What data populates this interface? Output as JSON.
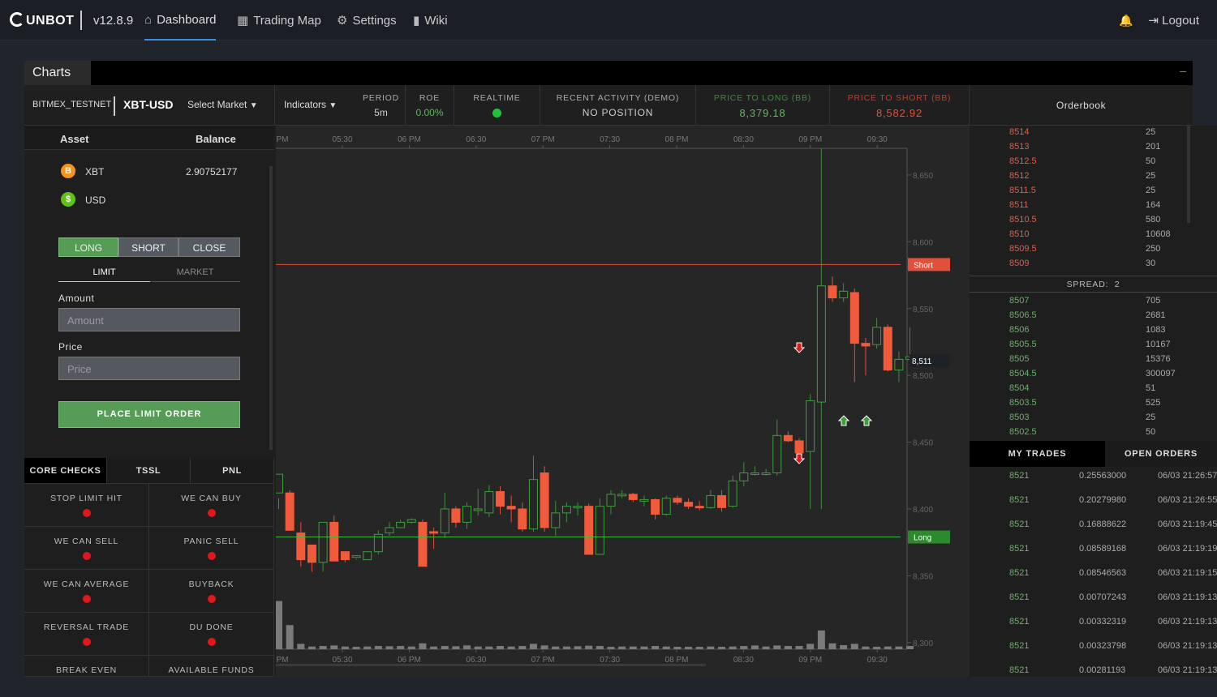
{
  "nav": {
    "logo": "UNBOT",
    "version": "v12.8.9",
    "items": [
      {
        "label": "Dashboard",
        "icon": "home-icon"
      },
      {
        "label": "Trading Map",
        "icon": "grid-icon"
      },
      {
        "label": "Settings",
        "icon": "gear-icon"
      },
      {
        "label": "Wiki",
        "icon": "book-icon"
      }
    ],
    "logout": "Logout"
  },
  "panel": {
    "title": "Charts",
    "minimize": "–"
  },
  "stats": {
    "exchange": "BITMEX_TESTNET",
    "pair": "XBT-USD",
    "select_market": "Select Market",
    "indicators": "Indicators",
    "period_label": "PERIOD",
    "period_value": "5m",
    "roe_label": "ROE",
    "roe_value": "0.00%",
    "realtime_label": "REALTIME",
    "activity_label": "RECENT ACTIVITY (DEMO)",
    "activity_value": "NO POSITION",
    "long_label": "PRICE TO LONG (BB)",
    "long_value": "8,379.18",
    "short_label": "PRICE TO SHORT (BB)",
    "short_value": "8,582.92",
    "colors": {
      "long": "#5fba5f",
      "short": "#e2503c",
      "realtime": "#22c33b"
    }
  },
  "balances": {
    "asset_header": "Asset",
    "balance_header": "Balance",
    "rows": [
      {
        "asset": "XBT",
        "balance": "2.90752177",
        "icon": "bitcoin-icon",
        "color": "#f7931a"
      },
      {
        "asset": "USD",
        "balance": "",
        "icon": "dollar-icon",
        "color": "#5fc316"
      }
    ]
  },
  "order_form": {
    "sides": [
      "LONG",
      "SHORT",
      "CLOSE"
    ],
    "types": [
      "LIMIT",
      "MARKET"
    ],
    "amount_label": "Amount",
    "amount_placeholder": "Amount",
    "price_label": "Price",
    "price_placeholder": "Price",
    "submit": "PLACE LIMIT ORDER"
  },
  "checks": {
    "tabs": [
      "CORE CHECKS",
      "TSSL",
      "PNL"
    ],
    "items": [
      "STOP LIMIT HIT",
      "WE CAN BUY",
      "WE CAN SELL",
      "PANIC SELL",
      "WE CAN AVERAGE",
      "BUYBACK",
      "REVERSAL TRADE",
      "DU DONE",
      "BREAK EVEN",
      "AVAILABLE FUNDS"
    ]
  },
  "orderbook": {
    "title": "Orderbook",
    "asks": [
      {
        "price": "8514",
        "qty": "25"
      },
      {
        "price": "8513",
        "qty": "201"
      },
      {
        "price": "8512.5",
        "qty": "50"
      },
      {
        "price": "8512",
        "qty": "25"
      },
      {
        "price": "8511.5",
        "qty": "25"
      },
      {
        "price": "8511",
        "qty": "164"
      },
      {
        "price": "8510.5",
        "qty": "580"
      },
      {
        "price": "8510",
        "qty": "10608"
      },
      {
        "price": "8509.5",
        "qty": "250"
      },
      {
        "price": "8509",
        "qty": "30"
      }
    ],
    "spread_label": "SPREAD:",
    "spread_value": "2",
    "bids": [
      {
        "price": "8507",
        "qty": "705"
      },
      {
        "price": "8506.5",
        "qty": "2681"
      },
      {
        "price": "8506",
        "qty": "1083"
      },
      {
        "price": "8505.5",
        "qty": "10167"
      },
      {
        "price": "8505",
        "qty": "15376"
      },
      {
        "price": "8504.5",
        "qty": "300097"
      },
      {
        "price": "8504",
        "qty": "51"
      },
      {
        "price": "8503.5",
        "qty": "525"
      },
      {
        "price": "8503",
        "qty": "25"
      },
      {
        "price": "8502.5",
        "qty": "50"
      }
    ]
  },
  "trades": {
    "tabs": [
      "MY TRADES",
      "OPEN ORDERS"
    ],
    "rows": [
      {
        "price": "8521",
        "amount": "0.25563000",
        "date": "06/03 21:26:57"
      },
      {
        "price": "8521",
        "amount": "0.20279980",
        "date": "06/03 21:26:55"
      },
      {
        "price": "8521",
        "amount": "0.16888622",
        "date": "06/03 21:19:45"
      },
      {
        "price": "8521",
        "amount": "0.08589168",
        "date": "06/03 21:19:19"
      },
      {
        "price": "8521",
        "amount": "0.08546563",
        "date": "06/03 21:19:15"
      },
      {
        "price": "8521",
        "amount": "0.00707243",
        "date": "06/03 21:19:13"
      },
      {
        "price": "8521",
        "amount": "0.00332319",
        "date": "06/03 21:19:13"
      },
      {
        "price": "8521",
        "amount": "0.00323798",
        "date": "06/03 21:19:13"
      },
      {
        "price": "8521",
        "amount": "0.00281193",
        "date": "06/03 21:19:13"
      }
    ]
  },
  "chart_data": {
    "type": "candlestick",
    "x_ticks": [
      "PM",
      "05:30",
      "06 PM",
      "06:30",
      "07 PM",
      "07:30",
      "08 PM",
      "08:30",
      "09 PM",
      "09:30"
    ],
    "y_ticks": [
      "8,650",
      "8,600",
      "8,550",
      "8,500",
      "8,450",
      "8,400",
      "8,350",
      "8,300"
    ],
    "ylim": [
      8295,
      8670
    ],
    "short_line": {
      "label": "Short",
      "value": 8583,
      "color": "#e2503c"
    },
    "long_line": {
      "label": "Long",
      "value": 8379,
      "color": "#3bc13b"
    },
    "last_price": "8,511",
    "up_color": "#3c9e3c",
    "down_color": "#f15a3b",
    "candles": [
      [
        8412,
        8426,
        8408,
        8400
      ],
      [
        8412,
        8384,
        8384,
        8414
      ],
      [
        8382,
        8362,
        8390,
        8357
      ],
      [
        8373,
        8360,
        8364,
        8353
      ],
      [
        8360,
        8390,
        8383,
        8353
      ],
      [
        8390,
        8361,
        8361,
        8395
      ],
      [
        8368,
        8362,
        8366,
        8360
      ],
      [
        8365,
        8365,
        8363,
        8362
      ],
      [
        8362,
        8368,
        8360,
        8360
      ],
      [
        8368,
        8381,
        8384,
        8366
      ],
      [
        8382,
        8386,
        8390,
        8380
      ],
      [
        8386,
        8390,
        8392,
        8386
      ],
      [
        8390,
        8392,
        8393,
        8389
      ],
      [
        8390,
        8357,
        8357,
        8392
      ],
      [
        8383,
        8382,
        8386,
        8370
      ],
      [
        8382,
        8400,
        8412,
        8378
      ],
      [
        8400,
        8390,
        8402,
        8386
      ],
      [
        8390,
        8402,
        8405,
        8385
      ],
      [
        8400,
        8400,
        8415,
        8395
      ],
      [
        8397,
        8413,
        8418,
        8394
      ],
      [
        8413,
        8402,
        8417,
        8396
      ],
      [
        8402,
        8400,
        8410,
        8390
      ],
      [
        8400,
        8385,
        8405,
        8383
      ],
      [
        8385,
        8422,
        8440,
        8383
      ],
      [
        8427,
        8386,
        8432,
        8383
      ],
      [
        8386,
        8397,
        8406,
        8380
      ],
      [
        8397,
        8402,
        8405,
        8390
      ],
      [
        8402,
        8402,
        8405,
        8395
      ],
      [
        8402,
        8366,
        8404,
        8366
      ],
      [
        8366,
        8402,
        8408,
        8366
      ],
      [
        8402,
        8411,
        8414,
        8396
      ],
      [
        8411,
        8411,
        8414,
        8408
      ],
      [
        8411,
        8407,
        8412,
        8405
      ],
      [
        8407,
        8407,
        8410,
        8402
      ],
      [
        8407,
        8396,
        8408,
        8392
      ],
      [
        8396,
        8408,
        8410,
        8395
      ],
      [
        8408,
        8405,
        8410,
        8403
      ],
      [
        8405,
        8402,
        8408,
        8400
      ],
      [
        8402,
        8401,
        8406,
        8399
      ],
      [
        8401,
        8410,
        8414,
        8400
      ],
      [
        8410,
        8401,
        8414,
        8398
      ],
      [
        8402,
        8421,
        8425,
        8401
      ],
      [
        8421,
        8427,
        8435,
        8417
      ],
      [
        8427,
        8427,
        8432,
        8425
      ],
      [
        8427,
        8427,
        8430,
        8425
      ],
      [
        8427,
        8455,
        8467,
        8425
      ],
      [
        8455,
        8451,
        8458,
        8450
      ],
      [
        8451,
        8442,
        8453,
        8440
      ],
      [
        8443,
        8481,
        8486,
        8400
      ],
      [
        8480,
        8567,
        8670,
        8400
      ],
      [
        8567,
        8558,
        8574,
        8555
      ],
      [
        8558,
        8563,
        8569,
        8555
      ],
      [
        8562,
        8524,
        8565,
        8495
      ],
      [
        8524,
        8522,
        8528,
        8500
      ],
      [
        8523,
        8536,
        8543,
        8520
      ],
      [
        8536,
        8504,
        8538,
        8503
      ],
      [
        8504,
        8512,
        8518,
        8495
      ],
      [
        8512,
        8514,
        8536,
        8508
      ]
    ],
    "volumes": [
      180,
      90,
      20,
      10,
      12,
      14,
      10,
      9,
      10,
      12,
      11,
      12,
      10,
      22,
      10,
      12,
      11,
      14,
      10,
      10,
      12,
      10,
      12,
      20,
      14,
      10,
      10,
      11,
      13,
      12,
      9,
      10,
      10,
      10,
      12,
      10,
      9,
      9,
      9,
      10,
      9,
      10,
      12,
      14,
      10,
      14,
      12,
      12,
      20,
      70,
      22,
      15,
      20,
      10,
      9,
      10,
      10,
      12
    ]
  }
}
